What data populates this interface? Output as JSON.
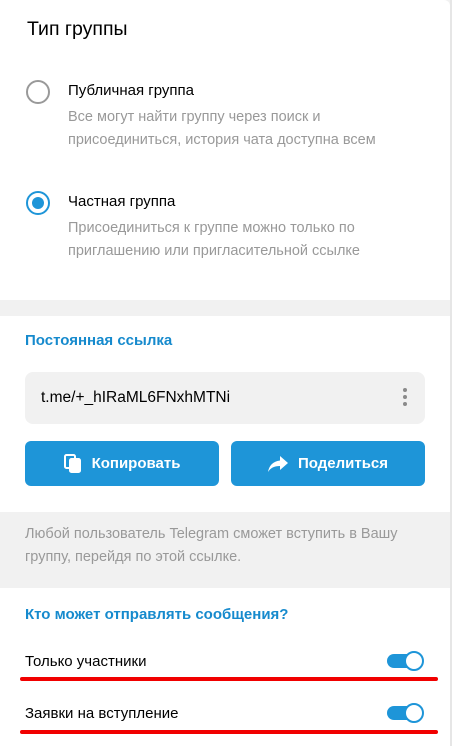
{
  "group_type": {
    "title": "Тип группы",
    "options": [
      {
        "title": "Публичная группа",
        "description": "Все могут найти группу через поиск и присоединиться, история чата доступна всем",
        "selected": false
      },
      {
        "title": "Частная группа",
        "description": "Присоединиться к группе можно только по приглашению или пригласительной ссылке",
        "selected": true
      }
    ]
  },
  "permanent_link": {
    "heading": "Постоянная ссылка",
    "value": "t.me/+_hIRaML6FNxhMTNi",
    "menu_icon": "more-vertical-icon",
    "copy_label": "Копировать",
    "copy_icon": "copy-icon",
    "share_label": "Поделиться",
    "share_icon": "share-arrow-icon",
    "hint": "Любой пользователь Telegram сможет вступить в Вашу группу, перейдя по этой ссылке."
  },
  "permissions": {
    "heading": "Кто может отправлять сообщения?",
    "toggles": [
      {
        "label": "Только участники",
        "on": true
      },
      {
        "label": "Заявки на вступление",
        "on": true
      }
    ]
  },
  "colors": {
    "accent": "#1e95d8",
    "heading_blue": "#168acd",
    "annotation_red": "#f10000",
    "muted_text": "#999999",
    "background": "#f1f1f1"
  }
}
